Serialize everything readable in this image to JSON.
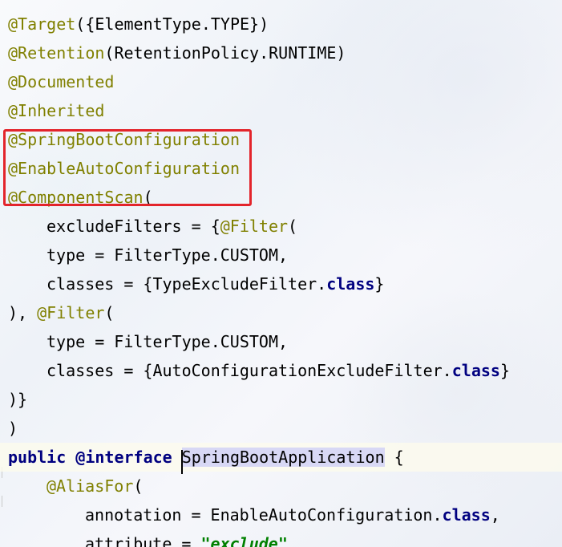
{
  "editor": {
    "lines": [
      {
        "parts": [
          {
            "cls": "ann",
            "text": "@Target"
          },
          {
            "cls": "txt",
            "text": "({ElementType."
          },
          {
            "cls": "txt",
            "text": "TYPE"
          },
          {
            "cls": "txt",
            "text": "})"
          }
        ]
      },
      {
        "parts": [
          {
            "cls": "ann",
            "text": "@Retention"
          },
          {
            "cls": "txt",
            "text": "(RetentionPolicy."
          },
          {
            "cls": "txt",
            "text": "RUNTIME"
          },
          {
            "cls": "txt",
            "text": ")"
          }
        ]
      },
      {
        "parts": [
          {
            "cls": "ann",
            "text": "@Documented"
          }
        ]
      },
      {
        "parts": [
          {
            "cls": "ann",
            "text": "@Inherited"
          }
        ]
      },
      {
        "parts": [
          {
            "cls": "ann",
            "text": "@SpringBootConfiguration"
          }
        ]
      },
      {
        "parts": [
          {
            "cls": "ann",
            "text": "@EnableAutoConfiguration"
          }
        ]
      },
      {
        "parts": [
          {
            "cls": "ann",
            "text": "@ComponentScan"
          },
          {
            "cls": "txt",
            "text": "("
          }
        ]
      },
      {
        "indent": 1,
        "parts": [
          {
            "cls": "txt",
            "text": "excludeFilters = {"
          },
          {
            "cls": "ann",
            "text": "@Filter"
          },
          {
            "cls": "txt",
            "text": "("
          }
        ]
      },
      {
        "indent": 1,
        "parts": [
          {
            "cls": "txt",
            "text": "type = FilterType."
          },
          {
            "cls": "txt",
            "text": "CUSTOM"
          },
          {
            "cls": "txt",
            "text": ","
          }
        ]
      },
      {
        "indent": 1,
        "parts": [
          {
            "cls": "txt",
            "text": "classes = {TypeExcludeFilter."
          },
          {
            "cls": "kw",
            "text": "class"
          },
          {
            "cls": "txt",
            "text": "}"
          }
        ]
      },
      {
        "parts": [
          {
            "cls": "txt",
            "text": "), "
          },
          {
            "cls": "ann",
            "text": "@Filter"
          },
          {
            "cls": "txt",
            "text": "("
          }
        ]
      },
      {
        "indent": 1,
        "parts": [
          {
            "cls": "txt",
            "text": "type = FilterType."
          },
          {
            "cls": "txt",
            "text": "CUSTOM"
          },
          {
            "cls": "txt",
            "text": ","
          }
        ]
      },
      {
        "indent": 1,
        "parts": [
          {
            "cls": "txt",
            "text": "classes = {AutoConfigurationExcludeFilter."
          },
          {
            "cls": "kw",
            "text": "class"
          },
          {
            "cls": "txt",
            "text": "}"
          }
        ]
      },
      {
        "parts": [
          {
            "cls": "txt",
            "text": ")}"
          }
        ]
      },
      {
        "parts": [
          {
            "cls": "txt",
            "text": ")"
          }
        ]
      },
      {
        "current": true,
        "parts": [
          {
            "cls": "kw",
            "text": "public "
          },
          {
            "cls": "kw",
            "text": "@interface "
          },
          {
            "cls": "hl",
            "text": "SpringBootApplication"
          },
          {
            "cls": "txt",
            "text": " {"
          }
        ]
      },
      {
        "indent": 1,
        "parts": [
          {
            "cls": "ann",
            "text": "@AliasFor"
          },
          {
            "cls": "txt",
            "text": "("
          }
        ]
      },
      {
        "indent": 2,
        "parts": [
          {
            "cls": "txt",
            "text": "annotation = EnableAutoConfiguration."
          },
          {
            "cls": "kw",
            "text": "class"
          },
          {
            "cls": "txt",
            "text": ","
          }
        ]
      },
      {
        "indent": 2,
        "parts": [
          {
            "cls": "txt",
            "text": "attribute = "
          },
          {
            "cls": "str",
            "text": "\"exclude\""
          }
        ]
      }
    ]
  },
  "colors": {
    "annotation": "#808000",
    "keyword": "#000080",
    "string": "#008000",
    "highlight_box": "#e3242b",
    "identifier_highlight": "#d8d8f5"
  }
}
